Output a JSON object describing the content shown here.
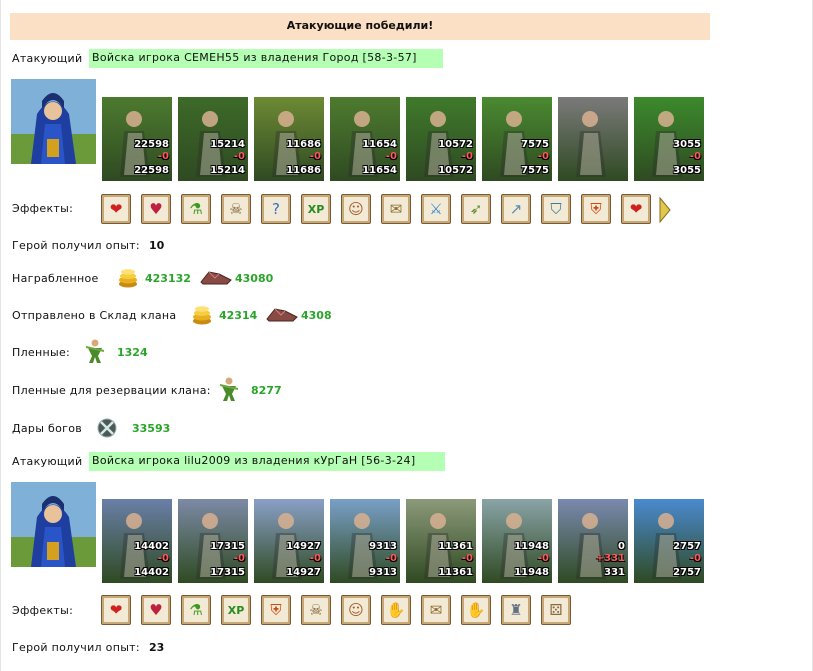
{
  "banner": "Атакующие победили!",
  "labels": {
    "attacker": "Атакующий",
    "effects": "Эффекты:",
    "xp": "Герой получил опыт:",
    "looted": "Награбленное",
    "sent_to_clan": "Отправлено в Склад клана",
    "prisoners": "Пленные:",
    "prisoners_clan": "Пленные для резервации клана:",
    "gifts": "Дары богов"
  },
  "army1": {
    "title": "Войска игрока СЕМЕН55 из владения Город [58-3-57]",
    "xp": "10",
    "units": [
      {
        "count": "22598",
        "loss": "-0",
        "remain": "22598",
        "color": "#4c7a2e"
      },
      {
        "count": "15214",
        "loss": "-0",
        "remain": "15214",
        "color": "#3d6a28"
      },
      {
        "count": "11686",
        "loss": "-0",
        "remain": "11686",
        "color": "#6d8a34"
      },
      {
        "count": "11654",
        "loss": "-0",
        "remain": "11654",
        "color": "#4e7b2f"
      },
      {
        "count": "10572",
        "loss": "-0",
        "remain": "10572",
        "color": "#3f7a2b"
      },
      {
        "count": "7575",
        "loss": "-0",
        "remain": "7575",
        "color": "#4a8a30"
      },
      {
        "count": "",
        "loss": "",
        "remain": "",
        "color": "#7a7a7a"
      },
      {
        "count": "3055",
        "loss": "-0",
        "remain": "3055",
        "color": "#3c8a2c"
      }
    ],
    "effects": [
      "heart-icon",
      "heal-icon",
      "potion-icon",
      "skull-icon",
      "question-icon",
      "xp-icon",
      "dwarf-icon",
      "scroll-icon",
      "sword-icon",
      "bow-icon",
      "lance-icon",
      "shield-spear-icon",
      "shield-icon",
      "heart-icon"
    ],
    "looted_gold": "423132",
    "looted_ore": "43080",
    "sent_gold": "42314",
    "sent_ore": "4308",
    "prisoners": "1324",
    "prisoners_clan": "8277",
    "gifts": "33593"
  },
  "army2": {
    "title": "Войска игрока lilu2009 из владения кУрГаН [56-3-24]",
    "xp": "23",
    "units": [
      {
        "count": "14402",
        "loss": "-0",
        "remain": "14402",
        "color": "#6a7fa8"
      },
      {
        "count": "17315",
        "loss": "-0",
        "remain": "17315",
        "color": "#7c8aa6"
      },
      {
        "count": "14927",
        "loss": "-0",
        "remain": "14927",
        "color": "#8aa0c8"
      },
      {
        "count": "9313",
        "loss": "-0",
        "remain": "9313",
        "color": "#7aa0c8"
      },
      {
        "count": "11361",
        "loss": "-0",
        "remain": "11361",
        "color": "#8c9a7a"
      },
      {
        "count": "11948",
        "loss": "-0",
        "remain": "11948",
        "color": "#8aa4a8"
      },
      {
        "count": "0",
        "loss": "+331",
        "remain": "331",
        "color": "#7a8ab0"
      },
      {
        "count": "2757",
        "loss": "-0",
        "remain": "2757",
        "color": "#4a8ad0"
      }
    ],
    "effects": [
      "heart-icon",
      "heal-icon",
      "potion-icon",
      "xp-icon",
      "shield-icon",
      "skull-icon",
      "dwarf-icon",
      "handshake-icon",
      "scroll-icon",
      "handshake-icon",
      "helmet-icon",
      "dice-icon"
    ]
  }
}
